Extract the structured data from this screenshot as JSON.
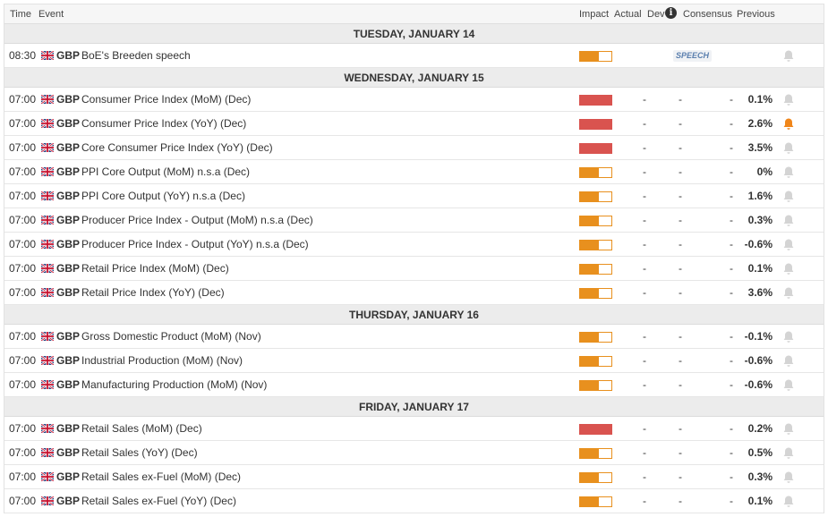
{
  "header": {
    "time": "Time",
    "event": "Event",
    "impact": "Impact",
    "actual": "Actual",
    "dev": "Dev",
    "info_glyph": "i",
    "consensus": "Consensus",
    "previous": "Previous"
  },
  "colors": {
    "high_impact": "#d9534f",
    "medium_impact": "#e8901e",
    "bell_active": "#f0861a",
    "bell_inactive": "#d4d4d4"
  },
  "days": [
    {
      "label": "TUESDAY, JANUARY 14",
      "events": [
        {
          "time": "08:30",
          "currency": "GBP",
          "name": "BoE's Breeden speech",
          "impact": "medium",
          "actual": "",
          "dev": "",
          "consensus": "",
          "previous": "",
          "tag": "SPEECH",
          "alert": false
        }
      ]
    },
    {
      "label": "WEDNESDAY, JANUARY 15",
      "events": [
        {
          "time": "07:00",
          "currency": "GBP",
          "name": "Consumer Price Index (MoM) (Dec)",
          "impact": "high",
          "actual": "-",
          "dev": "-",
          "consensus": "-",
          "previous": "0.1%",
          "alert": false
        },
        {
          "time": "07:00",
          "currency": "GBP",
          "name": "Consumer Price Index (YoY) (Dec)",
          "impact": "high",
          "actual": "-",
          "dev": "-",
          "consensus": "-",
          "previous": "2.6%",
          "alert": true
        },
        {
          "time": "07:00",
          "currency": "GBP",
          "name": "Core Consumer Price Index (YoY) (Dec)",
          "impact": "high",
          "actual": "-",
          "dev": "-",
          "consensus": "-",
          "previous": "3.5%",
          "alert": false
        },
        {
          "time": "07:00",
          "currency": "GBP",
          "name": "PPI Core Output (MoM) n.s.a (Dec)",
          "impact": "medium",
          "actual": "-",
          "dev": "-",
          "consensus": "-",
          "previous": "0%",
          "alert": false
        },
        {
          "time": "07:00",
          "currency": "GBP",
          "name": "PPI Core Output (YoY) n.s.a (Dec)",
          "impact": "medium",
          "actual": "-",
          "dev": "-",
          "consensus": "-",
          "previous": "1.6%",
          "alert": false
        },
        {
          "time": "07:00",
          "currency": "GBP",
          "name": "Producer Price Index - Output (MoM) n.s.a (Dec)",
          "impact": "medium",
          "actual": "-",
          "dev": "-",
          "consensus": "-",
          "previous": "0.3%",
          "alert": false
        },
        {
          "time": "07:00",
          "currency": "GBP",
          "name": "Producer Price Index - Output (YoY) n.s.a (Dec)",
          "impact": "medium",
          "actual": "-",
          "dev": "-",
          "consensus": "-",
          "previous": "-0.6%",
          "alert": false
        },
        {
          "time": "07:00",
          "currency": "GBP",
          "name": "Retail Price Index (MoM) (Dec)",
          "impact": "medium",
          "actual": "-",
          "dev": "-",
          "consensus": "-",
          "previous": "0.1%",
          "alert": false
        },
        {
          "time": "07:00",
          "currency": "GBP",
          "name": "Retail Price Index (YoY) (Dec)",
          "impact": "medium",
          "actual": "-",
          "dev": "-",
          "consensus": "-",
          "previous": "3.6%",
          "alert": false
        }
      ]
    },
    {
      "label": "THURSDAY, JANUARY 16",
      "events": [
        {
          "time": "07:00",
          "currency": "GBP",
          "name": "Gross Domestic Product (MoM) (Nov)",
          "impact": "medium",
          "actual": "-",
          "dev": "-",
          "consensus": "-",
          "previous": "-0.1%",
          "alert": false
        },
        {
          "time": "07:00",
          "currency": "GBP",
          "name": "Industrial Production (MoM) (Nov)",
          "impact": "medium",
          "actual": "-",
          "dev": "-",
          "consensus": "-",
          "previous": "-0.6%",
          "alert": false
        },
        {
          "time": "07:00",
          "currency": "GBP",
          "name": "Manufacturing Production (MoM) (Nov)",
          "impact": "medium",
          "actual": "-",
          "dev": "-",
          "consensus": "-",
          "previous": "-0.6%",
          "alert": false
        }
      ]
    },
    {
      "label": "FRIDAY, JANUARY 17",
      "events": [
        {
          "time": "07:00",
          "currency": "GBP",
          "name": "Retail Sales (MoM) (Dec)",
          "impact": "high",
          "actual": "-",
          "dev": "-",
          "consensus": "-",
          "previous": "0.2%",
          "alert": false
        },
        {
          "time": "07:00",
          "currency": "GBP",
          "name": "Retail Sales (YoY) (Dec)",
          "impact": "medium",
          "actual": "-",
          "dev": "-",
          "consensus": "-",
          "previous": "0.5%",
          "alert": false
        },
        {
          "time": "07:00",
          "currency": "GBP",
          "name": "Retail Sales ex-Fuel (MoM) (Dec)",
          "impact": "medium",
          "actual": "-",
          "dev": "-",
          "consensus": "-",
          "previous": "0.3%",
          "alert": false
        },
        {
          "time": "07:00",
          "currency": "GBP",
          "name": "Retail Sales ex-Fuel (YoY) (Dec)",
          "impact": "medium",
          "actual": "-",
          "dev": "-",
          "consensus": "-",
          "previous": "0.1%",
          "alert": false
        }
      ]
    }
  ]
}
